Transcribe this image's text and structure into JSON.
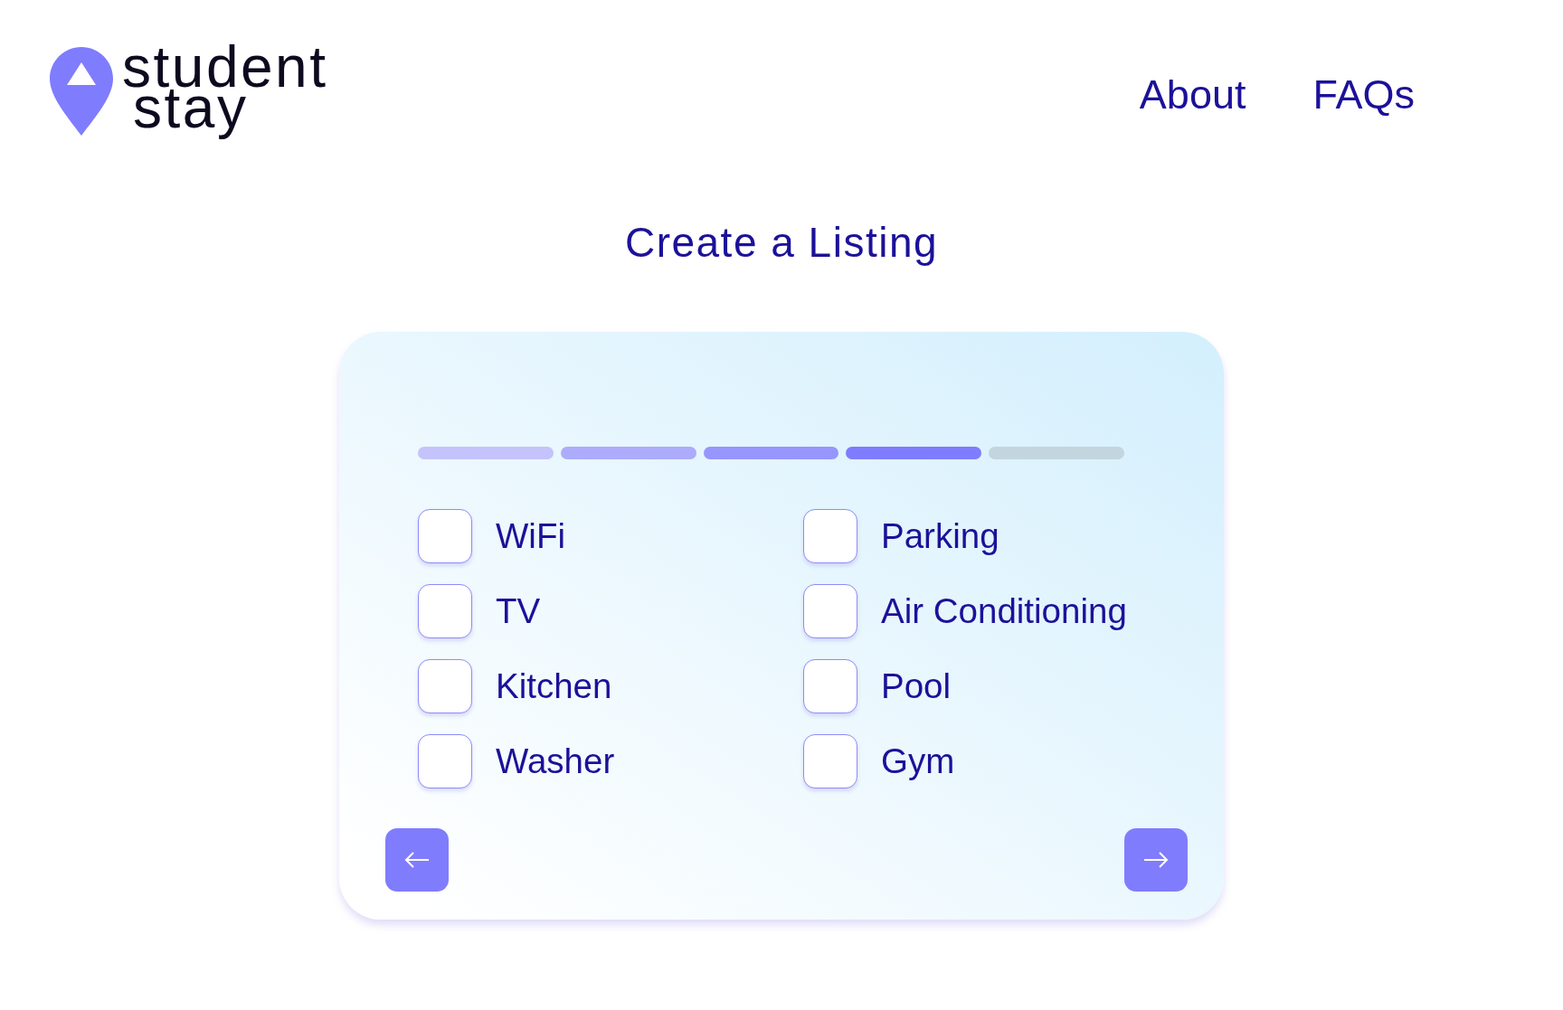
{
  "logo": {
    "lines": [
      "student",
      "stay"
    ]
  },
  "nav": [
    {
      "label": "About"
    },
    {
      "label": "FAQs"
    }
  ],
  "title": "Create a Listing",
  "progress": {
    "steps": [
      {
        "color": "#c4c3fb"
      },
      {
        "color": "#adabfc"
      },
      {
        "color": "#9796fd"
      },
      {
        "color": "#7f7cfe"
      },
      {
        "color": "#c3d5de"
      }
    ]
  },
  "amenities": [
    {
      "label": "WiFi",
      "checked": false
    },
    {
      "label": "Parking",
      "checked": false
    },
    {
      "label": "TV",
      "checked": false
    },
    {
      "label": "Air Conditioning",
      "checked": false
    },
    {
      "label": "Kitchen",
      "checked": false
    },
    {
      "label": "Pool",
      "checked": false
    },
    {
      "label": "Washer",
      "checked": false
    },
    {
      "label": "Gym",
      "checked": false
    }
  ]
}
